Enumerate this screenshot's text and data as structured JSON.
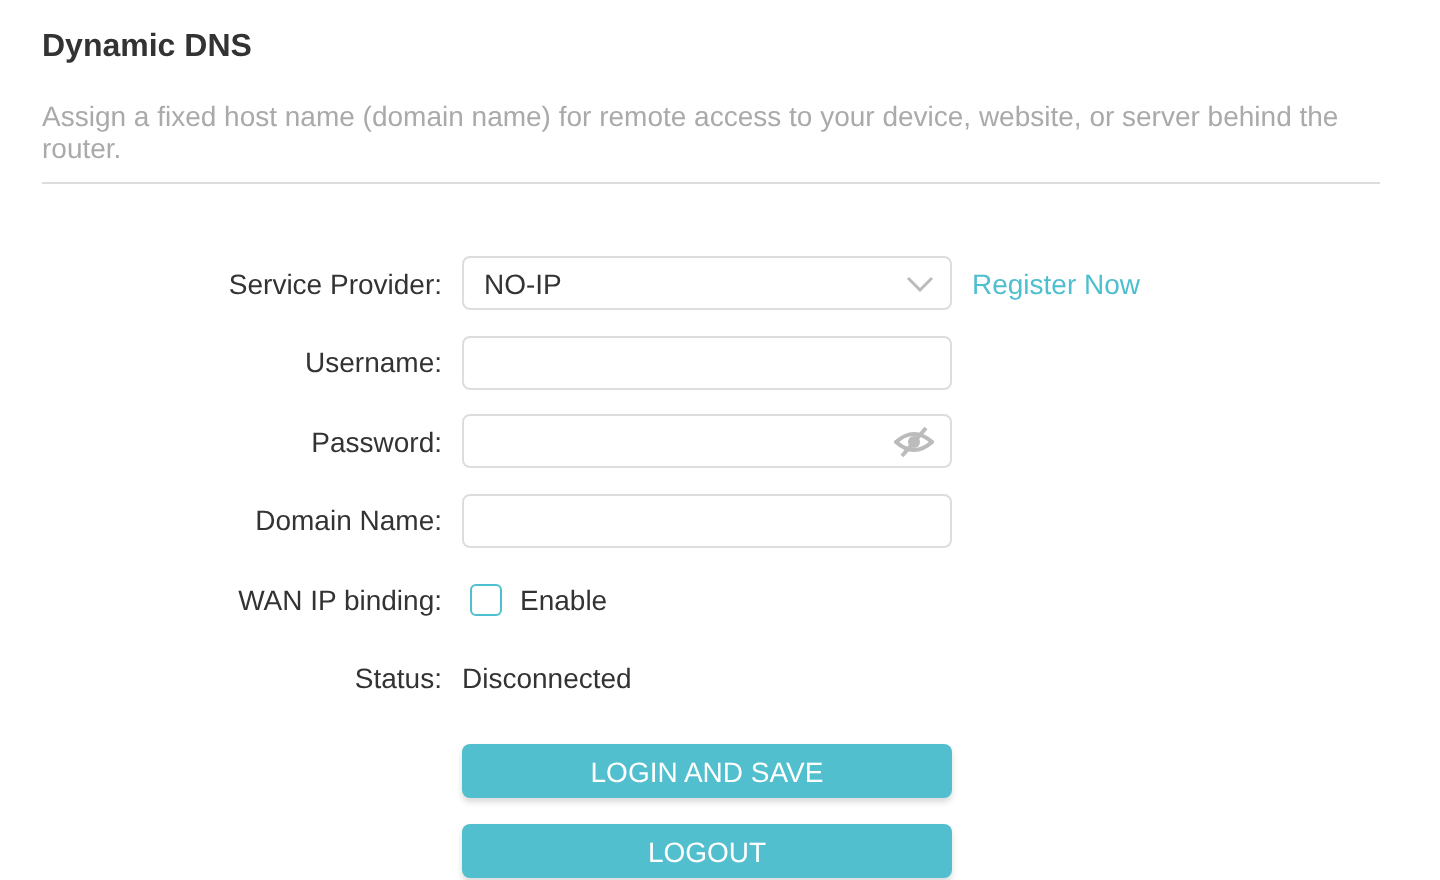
{
  "title": "Dynamic DNS",
  "description": "Assign a fixed host name (domain name) for remote access to your device, website, or server behind the router.",
  "fields": [
    {
      "kind": "select",
      "label": "Service Provider:",
      "value": "NO-IP",
      "link": "Register Now"
    },
    {
      "kind": "text",
      "label": "Username:"
    },
    {
      "kind": "password",
      "label": "Password:"
    },
    {
      "kind": "text",
      "label": "Domain Name:"
    },
    {
      "kind": "checkbox",
      "label": "WAN IP binding:",
      "option": "Enable",
      "checked": false
    },
    {
      "kind": "status",
      "label": "Status:",
      "value": "Disconnected"
    }
  ],
  "buttons": [
    "LOGIN AND SAVE",
    "LOGOUT"
  ]
}
